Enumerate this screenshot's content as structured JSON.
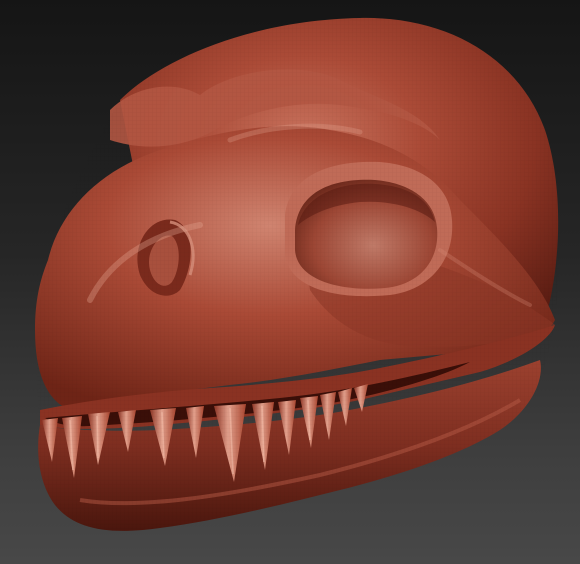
{
  "scene": {
    "subject": "sculpted-dinosaur-head-mask",
    "colors": {
      "background_top": "#151515",
      "background_bottom": "#484848",
      "clay_base": "#a4412f",
      "clay_shadow": "#5a1c12",
      "clay_highlight": "#d58c78",
      "tooth_base": "#b3503d",
      "tooth_highlight": "#e2a08c"
    }
  }
}
